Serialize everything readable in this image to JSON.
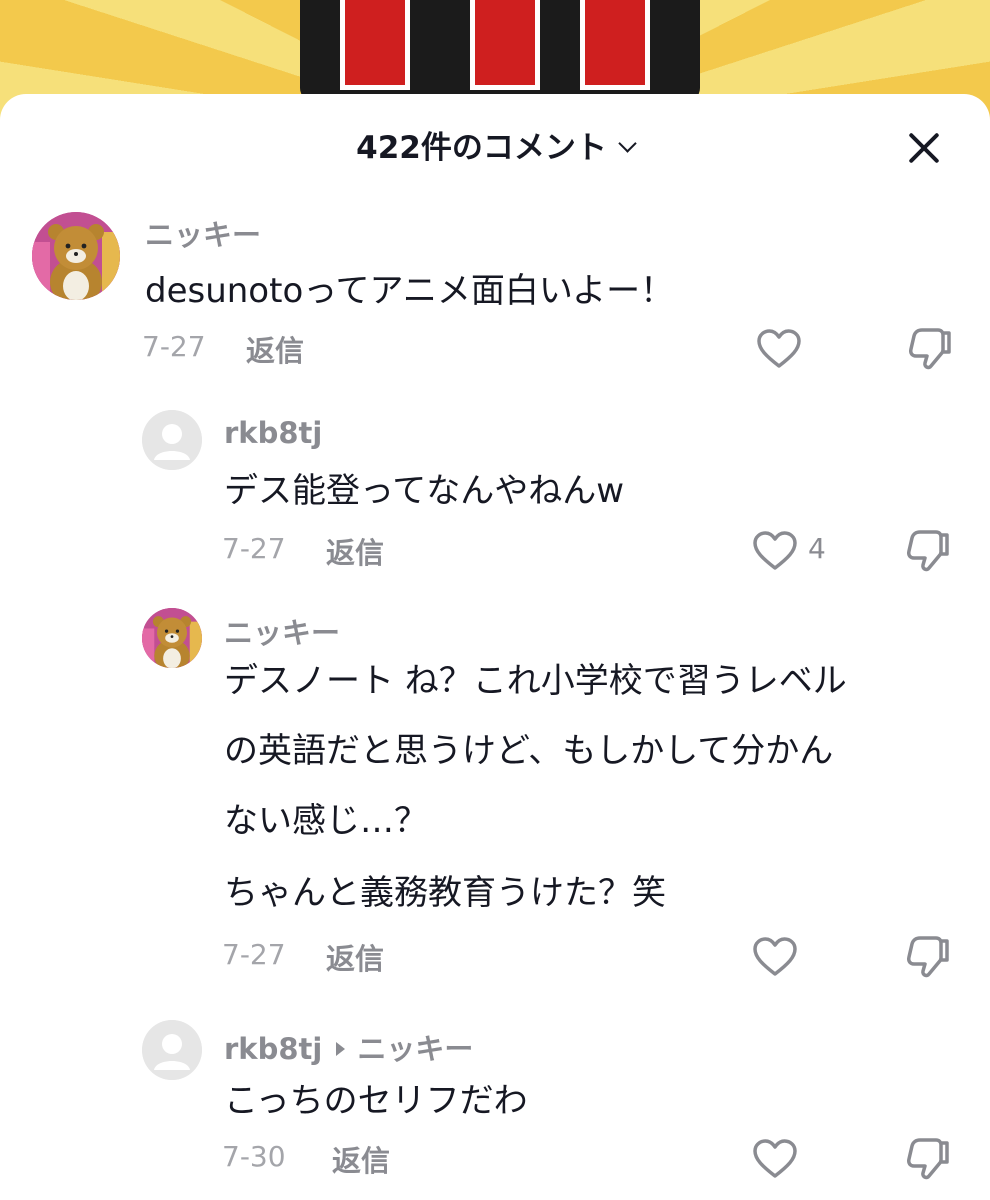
{
  "header": {
    "title": "422件のコメント"
  },
  "comments": [
    {
      "username": "ニッキー",
      "text_lines": [
        "desunotoってアニメ面白いよー！"
      ],
      "date": "7-27",
      "reply_label": "返信",
      "likes": "",
      "avatar": "bear-avatar"
    },
    {
      "username": "rkb8tj",
      "text_lines": [
        "デス能登ってなんやねんw"
      ],
      "date": "7-27",
      "reply_label": "返信",
      "likes": "4",
      "avatar": "default-avatar"
    },
    {
      "username": "ニッキー",
      "text_lines": [
        "デスノート ね？これ小学校で習うレベル",
        "の英語だと思うけど、もしかして分かん",
        "ない感じ…？",
        "ちゃんと義務教育うけた？笑"
      ],
      "date": "7-27",
      "reply_label": "返信",
      "likes": "",
      "avatar": "bear-avatar"
    },
    {
      "username": "rkb8tj",
      "reply_to": "ニッキー",
      "text_lines": [
        "こっちのセリフだわ"
      ],
      "date": "7-30",
      "reply_label": "返信",
      "likes": "",
      "avatar": "default-avatar"
    }
  ],
  "icons": {
    "like": "heart-outline-icon",
    "dislike": "thumbs-down-icon",
    "close": "close-icon"
  },
  "colors": {
    "text": "#161823",
    "muted": "#8a8b91",
    "date": "#a4a5aa"
  }
}
